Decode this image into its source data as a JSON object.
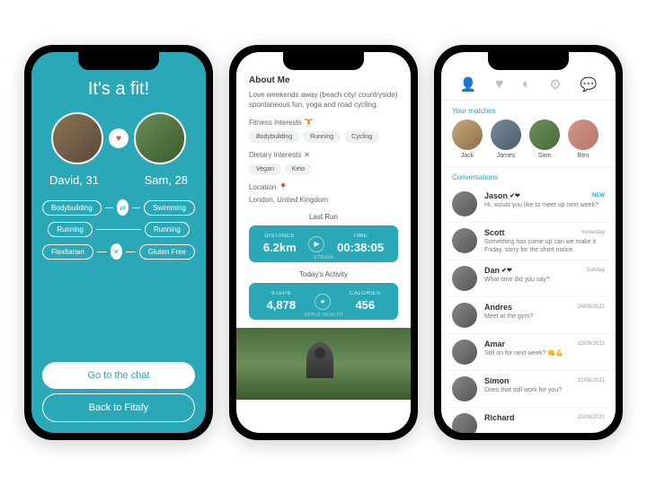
{
  "match": {
    "title": "It's a fit!",
    "user1": "David, 31",
    "user2": "Sam, 28",
    "traits": {
      "r1a": "Bodybuilding",
      "r1b": "Swimming",
      "r2a": "Running",
      "r2b": "Running",
      "r3a": "Flexitarian",
      "r3b": "Gluten Free"
    },
    "primary_btn": "Go to the chat",
    "secondary_btn": "Back to Fitafy"
  },
  "profile": {
    "about_h": "About Me",
    "bio": "Love weekends away (beach city/ countryside) spontaneous fun, yoga and road cycling.",
    "fitness_h": "Fitness Interests",
    "fitness": {
      "a": "Bodybuilding",
      "b": "Running",
      "c": "Cycling"
    },
    "diet_h": "Dietary Interests",
    "diet": {
      "a": "Vegan",
      "b": "Keto"
    },
    "loc_h": "Location",
    "loc": "London, United Kingdom",
    "last_run_h": "Last Run",
    "run": {
      "d_lbl": "DISTANCE",
      "d_val": "6.2km",
      "t_lbl": "TIME",
      "t_val": "00:38:05",
      "src": "STRAVA"
    },
    "today_h": "Today's Activity",
    "today": {
      "s_lbl": "STEPS",
      "s_val": "4,878",
      "c_lbl": "CALORIES",
      "c_val": "456",
      "src": "APPLE HEALTH"
    }
  },
  "chat": {
    "matches_h": "Your matches",
    "matches": {
      "a": "Jack",
      "b": "James",
      "c": "Sam",
      "d": "Ben"
    },
    "convs_h": "Conversations",
    "items": [
      {
        "name": "Jason",
        "msg": "Hi, would you like to meet up next week?",
        "time": "NEW",
        "new": true,
        "badge": "✔❤"
      },
      {
        "name": "Scott",
        "msg": "Something has come up can we make it Friday, sorry for the short notice.",
        "time": "Yesterday"
      },
      {
        "name": "Dan",
        "msg": "What time did you say?",
        "time": "Sunday",
        "badge": "✔❤"
      },
      {
        "name": "Andres",
        "msg": "Meet at the gym?",
        "time": "24/06/2021"
      },
      {
        "name": "Amar",
        "msg": "Still on for next week? 👊💪",
        "time": "23/06/2021"
      },
      {
        "name": "Simon",
        "msg": "Does that still work for you?",
        "time": "21/06/2021"
      },
      {
        "name": "Richard",
        "msg": "",
        "time": "20/06/2021"
      }
    ]
  }
}
